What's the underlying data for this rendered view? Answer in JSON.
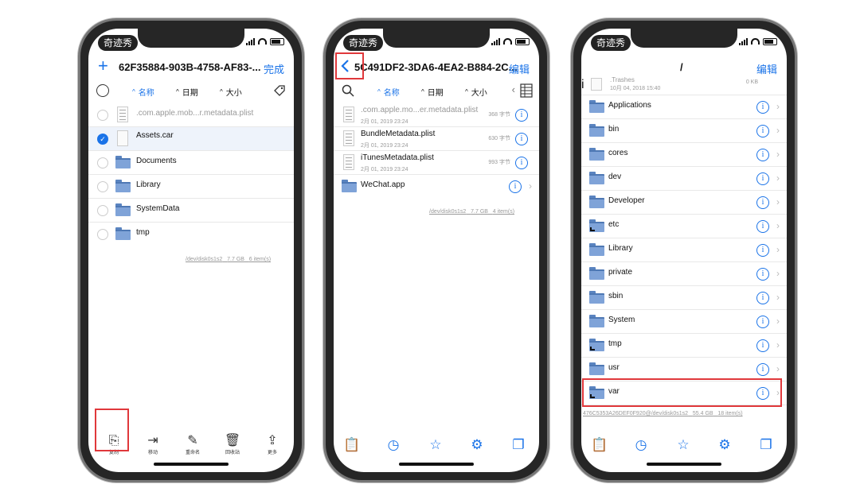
{
  "status": {
    "carrier": "奇迹秀"
  },
  "phone1": {
    "nav": {
      "add": "+",
      "title": "62F35884-903B-4758-AF83-...",
      "done": "完成"
    },
    "sort": {
      "name": "名称",
      "date": "日期",
      "size": "大小"
    },
    "items": [
      {
        "name": ".com.apple.mob...r.metadata.plist",
        "kind": "doc",
        "checked": false
      },
      {
        "name": "Assets.car",
        "kind": "blank",
        "checked": true
      },
      {
        "name": "Documents",
        "kind": "folder",
        "checked": false
      },
      {
        "name": "Library",
        "kind": "folder",
        "checked": false
      },
      {
        "name": "SystemData",
        "kind": "folder",
        "checked": false
      },
      {
        "name": "tmp",
        "kind": "folder",
        "checked": false
      }
    ],
    "footer": {
      "disk": "/dev/disk0s1s2",
      "free": "7.7 GB",
      "count": "6 item(s)"
    },
    "toolbar": {
      "copy": "复制",
      "move": "移动",
      "rename": "重命名",
      "trash": "回收站",
      "more": "更多"
    }
  },
  "phone2": {
    "nav": {
      "title": "5C491DF2-3DA6-4EA2-B884-2C...",
      "edit": "编辑"
    },
    "sort": {
      "name": "名称",
      "date": "日期",
      "size": "大小"
    },
    "items": [
      {
        "name": ".com.apple.mo...er.metadata.plist",
        "date": "2月 01, 2019 23:24",
        "size": "368 字节"
      },
      {
        "name": "BundleMetadata.plist",
        "date": "2月 01, 2019 23:24",
        "size": "630 字节"
      },
      {
        "name": "iTunesMetadata.plist",
        "date": "2月 01, 2019 23:24",
        "size": "993 字节"
      },
      {
        "name": "WeChat.app",
        "date": "",
        "size": ""
      }
    ],
    "footer": {
      "disk": "/dev/disk0s1s2",
      "free": "7.7 GB",
      "count": "4 item(s)"
    }
  },
  "phone3": {
    "nav": {
      "title": "/",
      "edit": "编辑"
    },
    "top_item": {
      "name": ".Trashes",
      "date": "10月 04, 2018 15:40",
      "size": "0 KB"
    },
    "items": [
      {
        "name": "Applications",
        "link": false
      },
      {
        "name": "bin",
        "link": false
      },
      {
        "name": "cores",
        "link": false
      },
      {
        "name": "dev",
        "link": false
      },
      {
        "name": "Developer",
        "link": false
      },
      {
        "name": "etc",
        "link": true
      },
      {
        "name": "Library",
        "link": false
      },
      {
        "name": "private",
        "link": false
      },
      {
        "name": "sbin",
        "link": false
      },
      {
        "name": "System",
        "link": false
      },
      {
        "name": "tmp",
        "link": true
      },
      {
        "name": "usr",
        "link": false
      },
      {
        "name": "var",
        "link": true
      }
    ],
    "footer": {
      "uuid": "476C5353A26DEF0F920@/dev/disk0s1s2",
      "free": "55.4 GB",
      "count": "18 item(s)"
    }
  },
  "colors": {
    "accent": "#1a73e8",
    "highlight": "#e0383b"
  }
}
